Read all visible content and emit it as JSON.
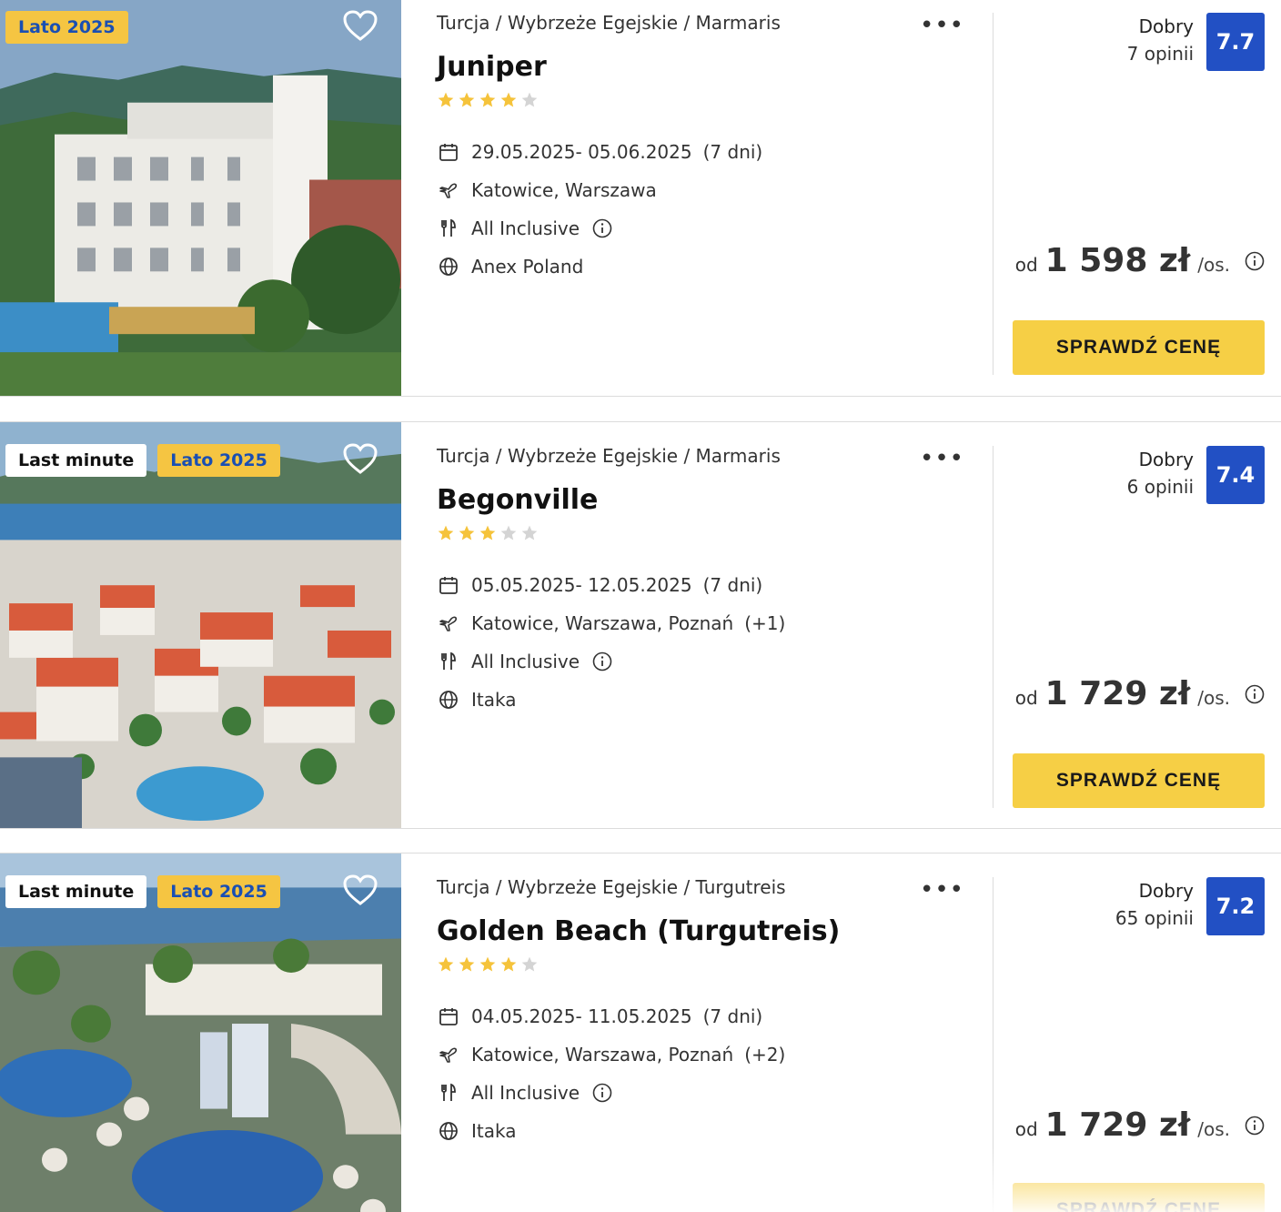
{
  "results": [
    {
      "badges": [
        "Lato 2025"
      ],
      "breadcrumb": "Turcja / Wybrzeże Egejskie / Marmaris",
      "name": "Juniper",
      "stars": 4,
      "dates": "29.05.2025- 05.06.2025",
      "duration": "(7 dni)",
      "departures": "Katowice, Warszawa",
      "departures_extra": "",
      "board": "All Inclusive",
      "operator": "Anex Poland",
      "rating_label": "Dobry",
      "reviews": "7 opinii",
      "score": "7.7",
      "price_prefix": "od",
      "price": "1 598 zł",
      "price_suffix": "/os.",
      "cta": "SPRAWDŹ CENĘ",
      "photo": "hotel-building"
    },
    {
      "badges": [
        "Last minute",
        "Lato 2025"
      ],
      "breadcrumb": "Turcja / Wybrzeże Egejskie / Marmaris",
      "name": "Begonville",
      "stars": 3,
      "dates": "05.05.2025- 12.05.2025",
      "duration": "(7 dni)",
      "departures": "Katowice, Warszawa, Poznań",
      "departures_extra": "(+1)",
      "board": "All Inclusive",
      "operator": "Itaka",
      "rating_label": "Dobry",
      "reviews": "6 opinii",
      "score": "7.4",
      "price_prefix": "od",
      "price": "1 729 zł",
      "price_suffix": "/os.",
      "cta": "SPRAWDŹ CENĘ",
      "photo": "town-bay"
    },
    {
      "badges": [
        "Last minute",
        "Lato 2025"
      ],
      "breadcrumb": "Turcja / Wybrzeże Egejskie / Turgutreis",
      "name": "Golden Beach (Turgutreis)",
      "stars": 4,
      "dates": "04.05.2025- 11.05.2025",
      "duration": "(7 dni)",
      "departures": "Katowice, Warszawa, Poznań",
      "departures_extra": "(+2)",
      "board": "All Inclusive",
      "operator": "Itaka",
      "rating_label": "Dobry",
      "reviews": "65 opinii",
      "score": "7.2",
      "price_prefix": "od",
      "price": "1 729 zł",
      "price_suffix": "/os.",
      "cta": "SPRAWDŹ CENĘ",
      "photo": "pool-resort"
    }
  ],
  "colors": {
    "score_bg": "#2250c4",
    "cta_bg": "#f6cf45",
    "badge_lato_bg": "#f5c542",
    "badge_lato_text": "#1a4fb3",
    "star_on": "#f5c33b",
    "star_off": "#d4d4d4"
  }
}
